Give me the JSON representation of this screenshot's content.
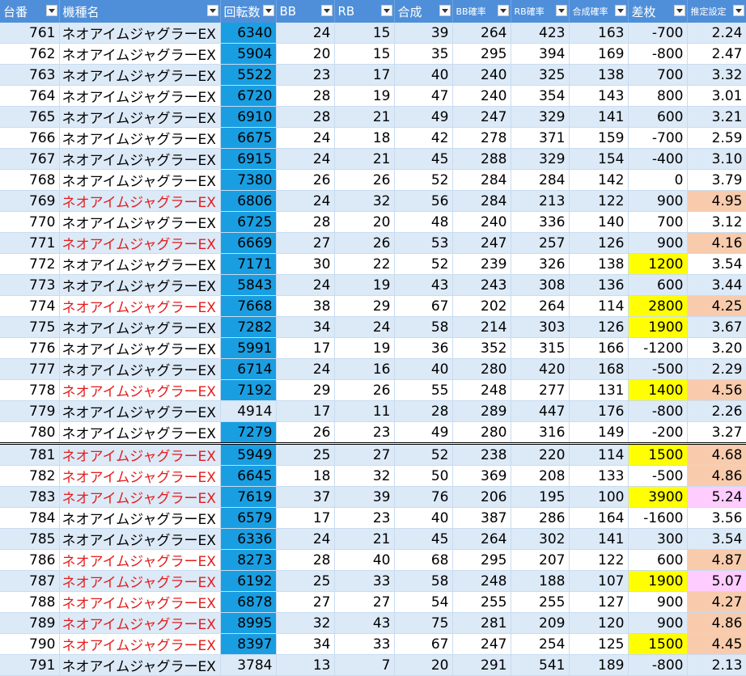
{
  "columns": [
    {
      "label": "台番",
      "small": false
    },
    {
      "label": "機種名",
      "small": false
    },
    {
      "label": "回転数",
      "small": false
    },
    {
      "label": "BB",
      "small": false
    },
    {
      "label": "RB",
      "small": false
    },
    {
      "label": "合成",
      "small": false
    },
    {
      "label": "BB確率",
      "small": true
    },
    {
      "label": "RB確率",
      "small": true
    },
    {
      "label": "合成確率",
      "small": true
    },
    {
      "label": "差枚",
      "small": false
    },
    {
      "label": "推定設定",
      "small": true
    }
  ],
  "colors": {
    "header_bg": "#4f8fd9",
    "spins_highlight": "#1a9ee2",
    "diff_highlight": "#ffff00",
    "setting_orange": "#f8cbad",
    "setting_pink": "#ffccff",
    "red_text": "#e31b1b"
  },
  "rows": [
    {
      "no": "761",
      "name": "ネオアイムジャグラーEX",
      "spins": "6340",
      "bb": "24",
      "rb": "15",
      "total": "39",
      "bbp": "264",
      "rbp": "423",
      "tp": "163",
      "diff": "-700",
      "est": "2.24",
      "red": false,
      "blue": true,
      "yellow": false,
      "estc": ""
    },
    {
      "no": "762",
      "name": "ネオアイムジャグラーEX",
      "spins": "5904",
      "bb": "20",
      "rb": "15",
      "total": "35",
      "bbp": "295",
      "rbp": "394",
      "tp": "169",
      "diff": "-800",
      "est": "2.47",
      "red": false,
      "blue": true,
      "yellow": false,
      "estc": ""
    },
    {
      "no": "763",
      "name": "ネオアイムジャグラーEX",
      "spins": "5522",
      "bb": "23",
      "rb": "17",
      "total": "40",
      "bbp": "240",
      "rbp": "325",
      "tp": "138",
      "diff": "700",
      "est": "3.32",
      "red": false,
      "blue": true,
      "yellow": false,
      "estc": ""
    },
    {
      "no": "764",
      "name": "ネオアイムジャグラーEX",
      "spins": "6720",
      "bb": "28",
      "rb": "19",
      "total": "47",
      "bbp": "240",
      "rbp": "354",
      "tp": "143",
      "diff": "800",
      "est": "3.01",
      "red": false,
      "blue": true,
      "yellow": false,
      "estc": ""
    },
    {
      "no": "765",
      "name": "ネオアイムジャグラーEX",
      "spins": "6910",
      "bb": "28",
      "rb": "21",
      "total": "49",
      "bbp": "247",
      "rbp": "329",
      "tp": "141",
      "diff": "600",
      "est": "3.21",
      "red": false,
      "blue": true,
      "yellow": false,
      "estc": ""
    },
    {
      "no": "766",
      "name": "ネオアイムジャグラーEX",
      "spins": "6675",
      "bb": "24",
      "rb": "18",
      "total": "42",
      "bbp": "278",
      "rbp": "371",
      "tp": "159",
      "diff": "-700",
      "est": "2.59",
      "red": false,
      "blue": true,
      "yellow": false,
      "estc": ""
    },
    {
      "no": "767",
      "name": "ネオアイムジャグラーEX",
      "spins": "6915",
      "bb": "24",
      "rb": "21",
      "total": "45",
      "bbp": "288",
      "rbp": "329",
      "tp": "154",
      "diff": "-400",
      "est": "3.10",
      "red": false,
      "blue": true,
      "yellow": false,
      "estc": ""
    },
    {
      "no": "768",
      "name": "ネオアイムジャグラーEX",
      "spins": "7380",
      "bb": "26",
      "rb": "26",
      "total": "52",
      "bbp": "284",
      "rbp": "284",
      "tp": "142",
      "diff": "0",
      "est": "3.79",
      "red": false,
      "blue": true,
      "yellow": false,
      "estc": ""
    },
    {
      "no": "769",
      "name": "ネオアイムジャグラーEX",
      "spins": "6806",
      "bb": "24",
      "rb": "32",
      "total": "56",
      "bbp": "284",
      "rbp": "213",
      "tp": "122",
      "diff": "900",
      "est": "4.95",
      "red": true,
      "blue": true,
      "yellow": false,
      "estc": "orange"
    },
    {
      "no": "770",
      "name": "ネオアイムジャグラーEX",
      "spins": "6725",
      "bb": "28",
      "rb": "20",
      "total": "48",
      "bbp": "240",
      "rbp": "336",
      "tp": "140",
      "diff": "700",
      "est": "3.12",
      "red": false,
      "blue": true,
      "yellow": false,
      "estc": ""
    },
    {
      "no": "771",
      "name": "ネオアイムジャグラーEX",
      "spins": "6669",
      "bb": "27",
      "rb": "26",
      "total": "53",
      "bbp": "247",
      "rbp": "257",
      "tp": "126",
      "diff": "900",
      "est": "4.16",
      "red": true,
      "blue": true,
      "yellow": false,
      "estc": "orange"
    },
    {
      "no": "772",
      "name": "ネオアイムジャグラーEX",
      "spins": "7171",
      "bb": "30",
      "rb": "22",
      "total": "52",
      "bbp": "239",
      "rbp": "326",
      "tp": "138",
      "diff": "1200",
      "est": "3.54",
      "red": false,
      "blue": true,
      "yellow": true,
      "estc": ""
    },
    {
      "no": "773",
      "name": "ネオアイムジャグラーEX",
      "spins": "5843",
      "bb": "24",
      "rb": "19",
      "total": "43",
      "bbp": "243",
      "rbp": "308",
      "tp": "136",
      "diff": "600",
      "est": "3.44",
      "red": false,
      "blue": true,
      "yellow": false,
      "estc": ""
    },
    {
      "no": "774",
      "name": "ネオアイムジャグラーEX",
      "spins": "7668",
      "bb": "38",
      "rb": "29",
      "total": "67",
      "bbp": "202",
      "rbp": "264",
      "tp": "114",
      "diff": "2800",
      "est": "4.25",
      "red": true,
      "blue": true,
      "yellow": true,
      "estc": "orange"
    },
    {
      "no": "775",
      "name": "ネオアイムジャグラーEX",
      "spins": "7282",
      "bb": "34",
      "rb": "24",
      "total": "58",
      "bbp": "214",
      "rbp": "303",
      "tp": "126",
      "diff": "1900",
      "est": "3.67",
      "red": false,
      "blue": true,
      "yellow": true,
      "estc": ""
    },
    {
      "no": "776",
      "name": "ネオアイムジャグラーEX",
      "spins": "5991",
      "bb": "17",
      "rb": "19",
      "total": "36",
      "bbp": "352",
      "rbp": "315",
      "tp": "166",
      "diff": "-1200",
      "est": "3.20",
      "red": false,
      "blue": true,
      "yellow": false,
      "estc": ""
    },
    {
      "no": "777",
      "name": "ネオアイムジャグラーEX",
      "spins": "6714",
      "bb": "24",
      "rb": "16",
      "total": "40",
      "bbp": "280",
      "rbp": "420",
      "tp": "168",
      "diff": "-500",
      "est": "2.29",
      "red": false,
      "blue": true,
      "yellow": false,
      "estc": ""
    },
    {
      "no": "778",
      "name": "ネオアイムジャグラーEX",
      "spins": "7192",
      "bb": "29",
      "rb": "26",
      "total": "55",
      "bbp": "248",
      "rbp": "277",
      "tp": "131",
      "diff": "1400",
      "est": "4.56",
      "red": true,
      "blue": true,
      "yellow": true,
      "estc": "orange"
    },
    {
      "no": "779",
      "name": "ネオアイムジャグラーEX",
      "spins": "4914",
      "bb": "17",
      "rb": "11",
      "total": "28",
      "bbp": "289",
      "rbp": "447",
      "tp": "176",
      "diff": "-800",
      "est": "2.26",
      "red": false,
      "blue": false,
      "yellow": false,
      "estc": ""
    },
    {
      "no": "780",
      "name": "ネオアイムジャグラーEX",
      "spins": "7279",
      "bb": "26",
      "rb": "23",
      "total": "49",
      "bbp": "280",
      "rbp": "316",
      "tp": "149",
      "diff": "-200",
      "est": "3.27",
      "red": false,
      "blue": true,
      "yellow": false,
      "estc": ""
    },
    {
      "no": "781",
      "name": "ネオアイムジャグラーEX",
      "spins": "5949",
      "bb": "25",
      "rb": "27",
      "total": "52",
      "bbp": "238",
      "rbp": "220",
      "tp": "114",
      "diff": "1500",
      "est": "4.68",
      "red": true,
      "blue": true,
      "yellow": true,
      "estc": "orange"
    },
    {
      "no": "782",
      "name": "ネオアイムジャグラーEX",
      "spins": "6645",
      "bb": "18",
      "rb": "32",
      "total": "50",
      "bbp": "369",
      "rbp": "208",
      "tp": "133",
      "diff": "-500",
      "est": "4.86",
      "red": true,
      "blue": true,
      "yellow": false,
      "estc": "orange"
    },
    {
      "no": "783",
      "name": "ネオアイムジャグラーEX",
      "spins": "7619",
      "bb": "37",
      "rb": "39",
      "total": "76",
      "bbp": "206",
      "rbp": "195",
      "tp": "100",
      "diff": "3900",
      "est": "5.24",
      "red": true,
      "blue": true,
      "yellow": true,
      "estc": "pink"
    },
    {
      "no": "784",
      "name": "ネオアイムジャグラーEX",
      "spins": "6579",
      "bb": "17",
      "rb": "23",
      "total": "40",
      "bbp": "387",
      "rbp": "286",
      "tp": "164",
      "diff": "-1600",
      "est": "3.56",
      "red": false,
      "blue": true,
      "yellow": false,
      "estc": ""
    },
    {
      "no": "785",
      "name": "ネオアイムジャグラーEX",
      "spins": "6336",
      "bb": "24",
      "rb": "21",
      "total": "45",
      "bbp": "264",
      "rbp": "302",
      "tp": "141",
      "diff": "300",
      "est": "3.54",
      "red": false,
      "blue": true,
      "yellow": false,
      "estc": ""
    },
    {
      "no": "786",
      "name": "ネオアイムジャグラーEX",
      "spins": "8273",
      "bb": "28",
      "rb": "40",
      "total": "68",
      "bbp": "295",
      "rbp": "207",
      "tp": "122",
      "diff": "600",
      "est": "4.87",
      "red": true,
      "blue": true,
      "yellow": false,
      "estc": "orange"
    },
    {
      "no": "787",
      "name": "ネオアイムジャグラーEX",
      "spins": "6192",
      "bb": "25",
      "rb": "33",
      "total": "58",
      "bbp": "248",
      "rbp": "188",
      "tp": "107",
      "diff": "1900",
      "est": "5.07",
      "red": true,
      "blue": true,
      "yellow": true,
      "estc": "pink"
    },
    {
      "no": "788",
      "name": "ネオアイムジャグラーEX",
      "spins": "6878",
      "bb": "27",
      "rb": "27",
      "total": "54",
      "bbp": "255",
      "rbp": "255",
      "tp": "127",
      "diff": "900",
      "est": "4.27",
      "red": true,
      "blue": true,
      "yellow": false,
      "estc": "orange"
    },
    {
      "no": "789",
      "name": "ネオアイムジャグラーEX",
      "spins": "8995",
      "bb": "32",
      "rb": "43",
      "total": "75",
      "bbp": "281",
      "rbp": "209",
      "tp": "120",
      "diff": "900",
      "est": "4.86",
      "red": true,
      "blue": true,
      "yellow": false,
      "estc": "orange"
    },
    {
      "no": "790",
      "name": "ネオアイムジャグラーEX",
      "spins": "8397",
      "bb": "34",
      "rb": "33",
      "total": "67",
      "bbp": "247",
      "rbp": "254",
      "tp": "125",
      "diff": "1500",
      "est": "4.45",
      "red": true,
      "blue": true,
      "yellow": true,
      "estc": "orange"
    },
    {
      "no": "791",
      "name": "ネオアイムジャグラーEX",
      "spins": "3784",
      "bb": "13",
      "rb": "7",
      "total": "20",
      "bbp": "291",
      "rbp": "541",
      "tp": "189",
      "diff": "-800",
      "est": "2.13",
      "red": false,
      "blue": false,
      "yellow": false,
      "estc": ""
    }
  ]
}
